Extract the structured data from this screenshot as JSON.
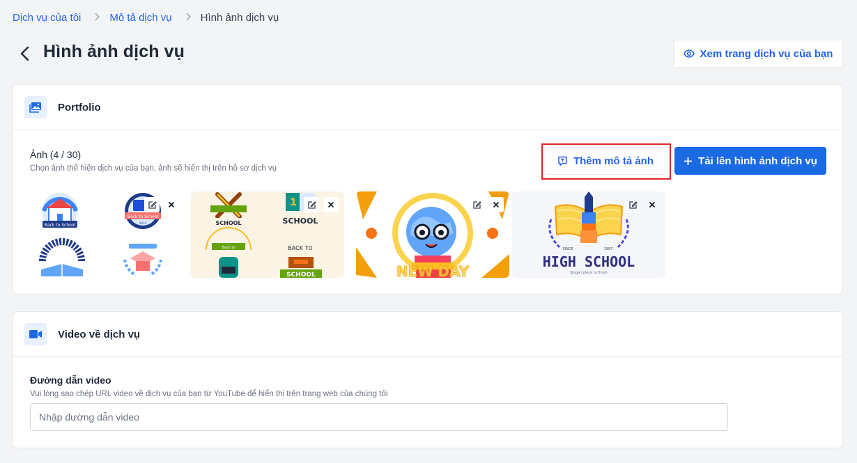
{
  "breadcrumb": {
    "items": [
      "Dịch vụ của tôi",
      "Mô tả dịch vụ"
    ],
    "current": "Hình ảnh dịch vụ",
    "separator": ">"
  },
  "header": {
    "title": "Hình ảnh dịch vụ",
    "view_button": "Xem trang dịch vụ của bạn"
  },
  "portfolio": {
    "title": "Portfolio",
    "images_label": "Ảnh (4 / 30)",
    "hint": "Chọn ảnh thể hiện dịch vụ của bạn, ảnh sẽ hiển thị trên hồ sơ dịch vụ",
    "add_description_button": "Thêm mô tả ảnh",
    "upload_button": "Tải lên hình ảnh dịch vụ",
    "thumbnails": [
      {
        "texts": [
          "Back to School",
          "Back to School",
          "2014"
        ]
      },
      {
        "texts": [
          "SCHOOL",
          "1",
          "SCHOOL",
          "Back to",
          "BACK TO",
          "SCHOOL"
        ]
      },
      {
        "texts": [
          "NEW DAY"
        ]
      },
      {
        "texts": [
          "HIGH SCHOOL",
          "SINCE",
          "1997",
          "Slogan place to finish"
        ]
      }
    ]
  },
  "video": {
    "title": "Video về dịch vụ",
    "field_label": "Đường dẫn video",
    "hint": "Vui lòng sao chép URL video về dịch vụ của bạn từ YouTube để hiển thị trên trang web của chúng tôi",
    "placeholder": "Nhập đường dẫn video"
  },
  "colors": {
    "accent": "#1a6ae3",
    "link": "#2563eb",
    "highlight": "#dc2626",
    "background": "#f3f4f6"
  },
  "icons": {
    "back": "chevron-left-icon",
    "view": "eye-icon",
    "portfolio": "image-gallery-icon",
    "video": "video-camera-icon",
    "description": "comment-text-icon",
    "upload": "plus-icon",
    "edit": "edit-icon",
    "remove": "close-icon"
  }
}
